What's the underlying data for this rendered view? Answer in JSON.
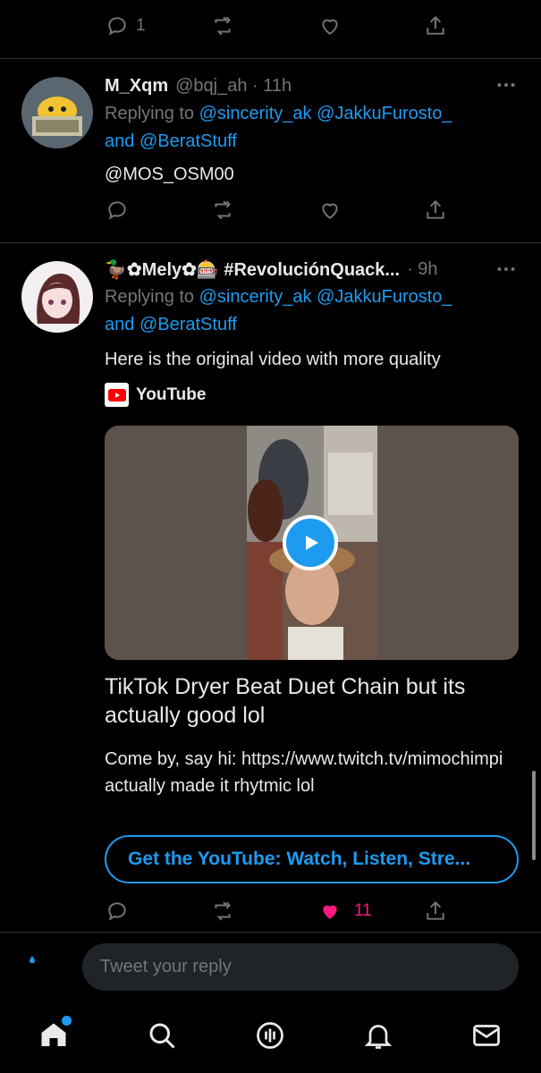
{
  "top_tweet_actions": {
    "reply_count": "1"
  },
  "tweets": [
    {
      "name": "M_Xqm",
      "handle": "@bqj_ah · 11h",
      "replying_prefix": "Replying to ",
      "replying_to_1": "@sincerity_ak @JakkuFurosto_",
      "replying_and": "and ",
      "replying_to_2": "@BeratStuff",
      "text": "@MOS_OSM00"
    },
    {
      "name": "🦆✿Mely✿🎰 #RevoluciónQuack...",
      "handle": "· 9h",
      "replying_prefix": "Replying to ",
      "replying_to_1": "@sincerity_ak @JakkuFurosto_",
      "replying_and": "and ",
      "replying_to_2": "@BeratStuff",
      "text": "Here is the original video with more quality",
      "source": "YouTube",
      "card": {
        "title": "TikTok Dryer Beat Duet Chain but its actually good lol",
        "description": "Come by, say hi: https://www.twitch.tv/mimochimpi actually made it rhytmic lol",
        "cta": "Get the YouTube: Watch, Listen, Stre..."
      },
      "like_count": "11",
      "like_color": "#f91880"
    }
  ],
  "reply_placeholder": "Tweet your reply",
  "accent_color": "#1d9bf0"
}
